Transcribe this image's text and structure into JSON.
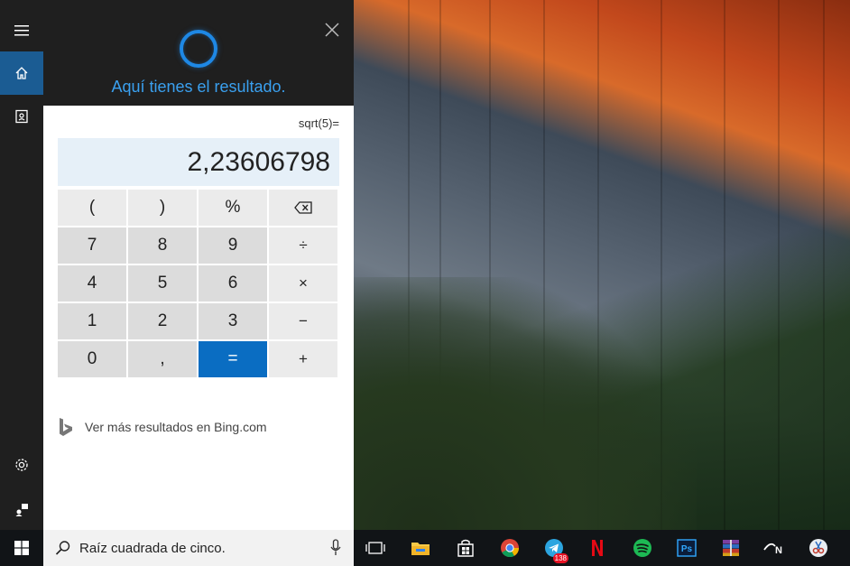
{
  "cortana": {
    "header_text": "Aquí tienes el resultado.",
    "colors": {
      "accent": "#1e88e5",
      "header_text": "#3aa0ef",
      "active_rail": "#1b5c93"
    }
  },
  "rail": {
    "items": [
      {
        "icon": "hamburger-menu-icon"
      },
      {
        "icon": "home-icon",
        "active": true
      },
      {
        "icon": "notebook-icon"
      },
      {
        "icon": "gear-icon"
      },
      {
        "icon": "feedback-icon"
      }
    ]
  },
  "calculator": {
    "expression": "sqrt(5)=",
    "result": "2,23606798",
    "rows": [
      [
        {
          "label": "(",
          "style": "light"
        },
        {
          "label": ")",
          "style": "light"
        },
        {
          "label": "%",
          "style": "light"
        },
        {
          "label": "⌫",
          "style": "op",
          "icon": "backspace-icon"
        }
      ],
      [
        {
          "label": "7"
        },
        {
          "label": "8"
        },
        {
          "label": "9"
        },
        {
          "label": "÷",
          "style": "op"
        }
      ],
      [
        {
          "label": "4"
        },
        {
          "label": "5"
        },
        {
          "label": "6"
        },
        {
          "label": "×",
          "style": "op"
        }
      ],
      [
        {
          "label": "1"
        },
        {
          "label": "2"
        },
        {
          "label": "3"
        },
        {
          "label": "−",
          "style": "op"
        }
      ],
      [
        {
          "label": "0"
        },
        {
          "label": ","
        },
        {
          "label": "=",
          "style": "eq"
        },
        {
          "label": "+",
          "style": "op"
        }
      ]
    ],
    "colors": {
      "result_bg": "#e6f0f8",
      "equals": "#0a6dc2"
    }
  },
  "bing": {
    "link_text": "Ver más resultados en Bing.com"
  },
  "taskbar": {
    "search_text": "Raíz cuadrada de cinco.",
    "apps": [
      {
        "name": "task-view-icon"
      },
      {
        "name": "file-explorer-icon"
      },
      {
        "name": "store-icon"
      },
      {
        "name": "chrome-icon"
      },
      {
        "name": "telegram-icon",
        "badge": "138"
      },
      {
        "name": "netflix-icon"
      },
      {
        "name": "spotify-icon"
      },
      {
        "name": "photoshop-icon",
        "label": "Ps"
      },
      {
        "name": "winrar-icon"
      },
      {
        "name": "app-n-icon",
        "label": "N"
      },
      {
        "name": "snipping-tool-icon"
      }
    ]
  }
}
